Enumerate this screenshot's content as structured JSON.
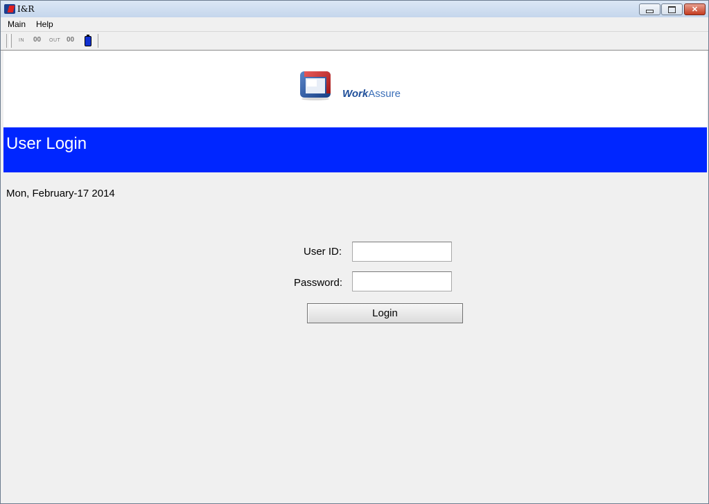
{
  "window": {
    "title": "I&R",
    "minimize_glyph": "",
    "maximize_glyph": "",
    "close_glyph": "✕"
  },
  "menu": {
    "main": "Main",
    "help": "Help"
  },
  "toolbar": {
    "in_label": "IN",
    "in_count": "00",
    "out_label": "OUT",
    "out_count": "00",
    "battery_icon": "battery-icon"
  },
  "logo": {
    "work": "Work",
    "assure": "Assure"
  },
  "banner": {
    "title": "User Login"
  },
  "date": "Mon, February-17 2014",
  "form": {
    "user_id_label": "User ID:",
    "user_id_value": "",
    "password_label": "Password:",
    "password_value": "",
    "login_label": "Login"
  },
  "colors": {
    "banner": "#0026ff",
    "battery": "#1030d0"
  }
}
